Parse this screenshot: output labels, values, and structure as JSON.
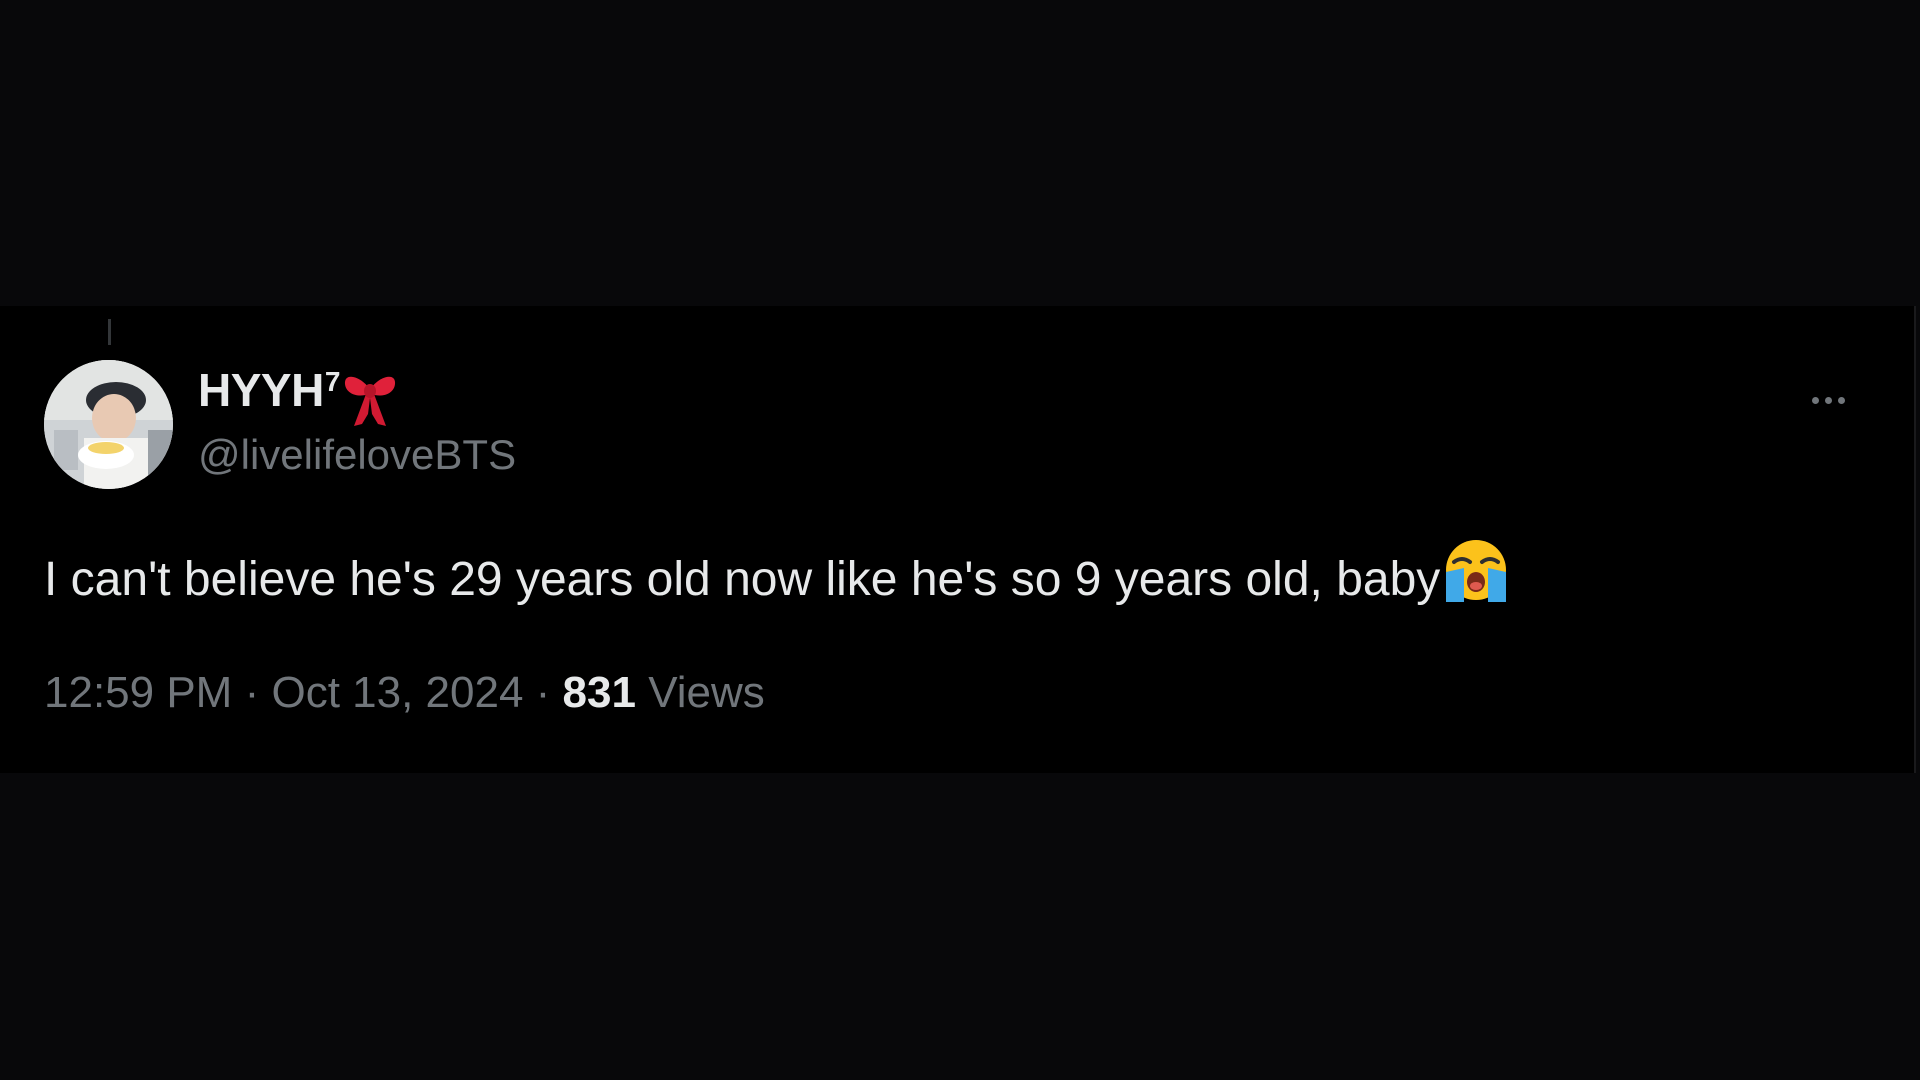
{
  "tweet": {
    "author": {
      "display_name": "HYYH",
      "display_name_superscript": "7",
      "name_emoji": "ribbon-icon",
      "handle": "@livelifeloveBTS",
      "avatar": "avatar"
    },
    "text": "I can't believe he's 29 years old now like he's so 9 years old, baby",
    "text_emoji": "loudly-crying-face-icon",
    "time": "12:59 PM",
    "separator": "·",
    "date": "Oct 13, 2024",
    "views_count": "831",
    "views_label": "Views",
    "more_icon": "more-icon"
  },
  "colors": {
    "background": "#000000",
    "page_background": "#08080a",
    "primary_text": "#e7e9ea",
    "secondary_text": "#71767b",
    "ribbon": "#e0213a"
  }
}
